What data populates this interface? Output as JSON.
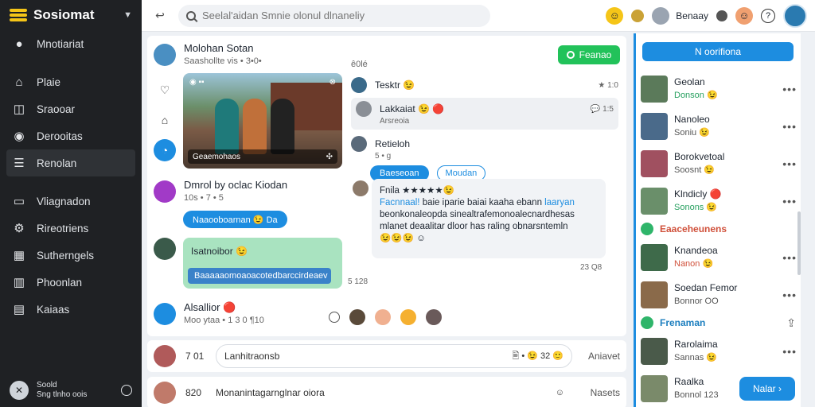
{
  "app": {
    "name": "Sosiomat"
  },
  "sidebar": {
    "items": [
      {
        "label": "Mnotiariat",
        "icon": "globe-icon",
        "active": false
      },
      {
        "label": "Plaie",
        "icon": "home-icon",
        "active": false
      },
      {
        "label": "Sraooar",
        "icon": "compose-icon",
        "active": false
      },
      {
        "label": "Derooitas",
        "icon": "palette-icon",
        "active": false
      },
      {
        "label": "Renolan",
        "icon": "document-icon",
        "active": true
      },
      {
        "label": "Vliagnadon",
        "icon": "monitor-icon",
        "active": false
      },
      {
        "label": "Rireotriens",
        "icon": "gear-icon",
        "active": false
      },
      {
        "label": "Sutherngels",
        "icon": "grid-icon",
        "active": false
      },
      {
        "label": "Phoonlan",
        "icon": "chart-icon",
        "active": false
      },
      {
        "label": "Kaiaas",
        "icon": "box-icon",
        "active": false
      }
    ],
    "profile": {
      "line1": "Soold",
      "line2": "Sng tlnho oois"
    }
  },
  "topbar": {
    "search_placeholder": "Seelal'aidan Smnie olonul dlnaneliy",
    "user_name": "Benaay"
  },
  "post": {
    "author": "Molohan Sotan",
    "sub": "Saashollte vis • 3•0•",
    "time": "ê0lé",
    "follow_label": "Feanao",
    "photo_caption": "Geaemohaos"
  },
  "comments": [
    {
      "name": "Tesktr 😉",
      "meta": "★ 1:0"
    },
    {
      "name": "Lakkaiat 😉 🔴",
      "meta": "💬 1:5",
      "sub": "Arsreoia"
    },
    {
      "name": "Retieloh",
      "sub": "5 • g",
      "btn1": "Baeseoan",
      "btn2": "Moudan"
    }
  ],
  "post2": {
    "name": "Dmrol by oclac Kiodan",
    "sub": "10s • 7 • 5",
    "pill": "Naaooboarnan 😉 Da"
  },
  "review": {
    "head": "Fnila ★★★★★😉",
    "hl1": "Facnnaal!",
    "line1": " baie iparie baiai kaaha ebann ",
    "hl2": "laaryan",
    "line2": "beonkonaleopda sinealtrafemonoalecnardhesas",
    "line3": "mlanet deaalitar dloor has raling obnarsntemln",
    "emojis": "😉😉😉 ☺",
    "time": "23 Q8"
  },
  "greencard": {
    "title": "Isatnoibor 😉",
    "bar": "Baaaaaomoaoacotedbarccirdeaev",
    "time": "5 128"
  },
  "post3": {
    "name": "Alsallior 🔴",
    "sub": "Moo ytaa • 1 3 0 ¶10"
  },
  "composer1": {
    "num": "7 01",
    "placeholder": "Lanhitraonsb",
    "tools": "🖹 • 😉 32 🙂",
    "send": "Aniavet"
  },
  "composer2": {
    "num": "820",
    "text": "Monanintagarnglnar oiora",
    "send": "Nasets"
  },
  "right": {
    "button": "N oorifiona",
    "contacts": [
      {
        "name": "Geolan",
        "status": "Donson 😉",
        "type": "person"
      },
      {
        "name": "Nanoleo",
        "status": "Soniu 😉",
        "type": "person"
      },
      {
        "name": "Borokvetoal",
        "status": "Soosnt 😉",
        "type": "person"
      },
      {
        "name": "Klndicly 🔴",
        "status": "Sonons 😉",
        "type": "person"
      },
      {
        "name": "Eaaceheunens",
        "status": "",
        "type": "group"
      },
      {
        "name": "Knandeoa",
        "status": "Nanon 😉",
        "type": "person"
      },
      {
        "name": "Soedan Femor",
        "status": "Bonnor OO",
        "type": "person"
      },
      {
        "name": "Frenaman",
        "status": "",
        "type": "group2"
      },
      {
        "name": "Rarolaima",
        "status": "Sannas 😉",
        "type": "person"
      },
      {
        "name": "Raalka",
        "status": "Bonnol 123",
        "type": "person"
      }
    ],
    "next_button": "Nalar"
  }
}
